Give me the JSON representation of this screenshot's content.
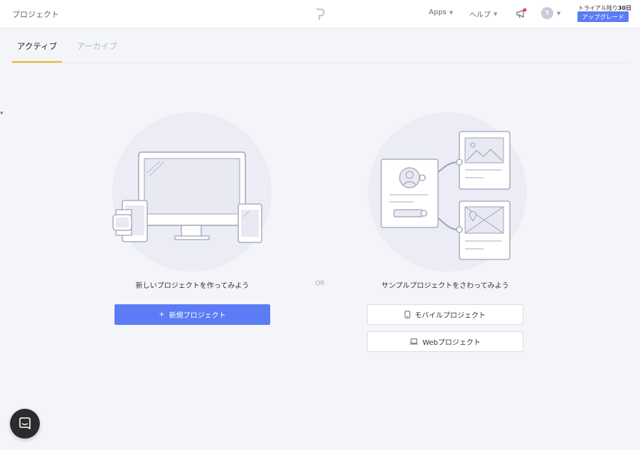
{
  "header": {
    "page_title": "プロジェクト",
    "apps_label": "Apps",
    "help_label": "ヘルプ",
    "avatar_initial": "T",
    "trial_prefix": "トライアル残り",
    "trial_days": "30日",
    "upgrade_label": "アップグレード"
  },
  "tabs": {
    "active_label": "アクティブ",
    "archive_label": "アーカイブ"
  },
  "left_panel": {
    "caption": "新しいプロジェクトを作ってみよう",
    "button_label": "新規プロジェクト",
    "button_prefix": "+"
  },
  "divider": {
    "or_label": "OR"
  },
  "right_panel": {
    "caption": "サンプルプロジェクトをさわってみよう",
    "mobile_button_label": "モバイルプロジェクト",
    "web_button_label": "Webプロジェクト"
  },
  "colors": {
    "accent": "#5b7cf5",
    "tab_underline": "#f2b51b",
    "notification_dot": "#e8434a"
  },
  "icons": {
    "logo": "prott-logo-icon",
    "bell": "megaphone-icon",
    "chat": "chat-icon",
    "mobile": "mobile-icon",
    "laptop": "laptop-icon"
  }
}
